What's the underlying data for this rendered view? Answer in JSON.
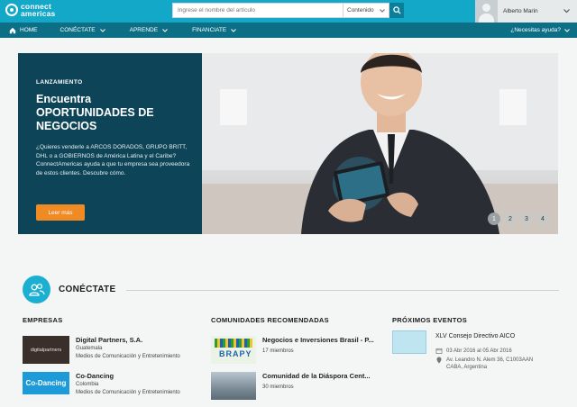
{
  "brand": {
    "line1": "connect",
    "line2": "americas",
    "color": "#13a7c8"
  },
  "search": {
    "placeholder": "Ingrese el nombre del artículo",
    "filter": "Contenido"
  },
  "user": {
    "name": "Alberto Marin"
  },
  "nav": {
    "home": "HOME",
    "items": [
      "CONÉCTATE",
      "APRENDE",
      "FINANCIATE"
    ],
    "help": "¿Necesitas ayuda?"
  },
  "hero": {
    "kicker": "LANZAMIENTO",
    "title_line1": "Encuentra",
    "title_line2": "OPORTUNIDADES DE NEGOCIOS",
    "description": "¿Quieres venderle a ARCOS DORADOS, GRUPO BRITT, DHL o a GOBIERNOS de América Latina y el Caribe? ConnectAmericas ayuda a que tu empresa sea proveedora de estos clientes. Descubre cómo.",
    "cta": "Leer más",
    "pages": [
      "1",
      "2",
      "3",
      "4"
    ],
    "accent": "#f08a24"
  },
  "section": {
    "title": "CONÉCTATE"
  },
  "companies": {
    "heading": "EMPRESAS",
    "items": [
      {
        "name": "Digital Partners, S.A.",
        "country": "Guatemala",
        "sector": "Medios de Comunicación y Entretenimiento",
        "thumb_text": "digitalpartners"
      },
      {
        "name": "Co-Dancing",
        "country": "Colombia",
        "sector": "Medios de Comunicación y Entretenimiento",
        "thumb_text": "Co-Dancing"
      }
    ]
  },
  "communities": {
    "heading": "COMUNIDADES RECOMENDADAS",
    "items": [
      {
        "name": "Negocios e Inversiones Brasil - P...",
        "members": "17 miembros",
        "thumb_text": "BRAPY"
      },
      {
        "name": "Comunidad de la Diáspora Cent...",
        "members": "30 miembros"
      }
    ]
  },
  "events": {
    "heading": "PRÓXIMOS EVENTOS",
    "items": [
      {
        "title": "XLV Consejo Directivo AICO",
        "date": "03 Abr 2016 al 05 Abr 2016",
        "address1": "Av. Leandro N. Alem 36, C1003AAN",
        "address2": "CABA, Argentina"
      }
    ]
  }
}
